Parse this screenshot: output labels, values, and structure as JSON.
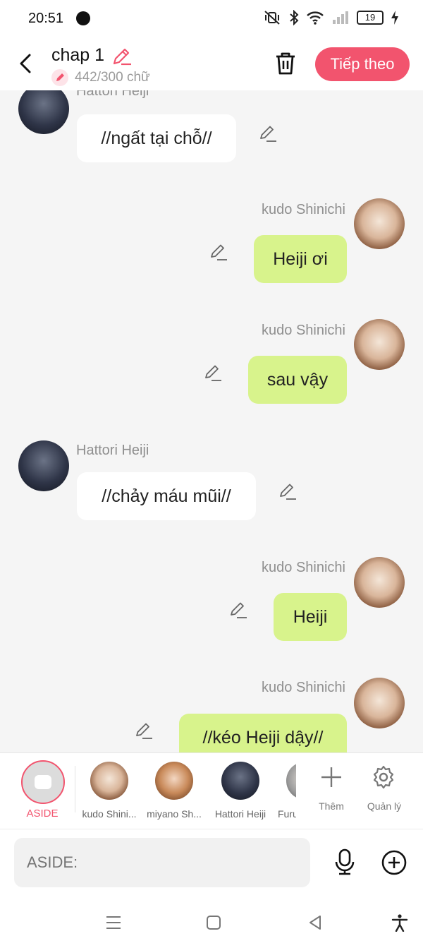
{
  "status": {
    "time": "20:51",
    "battery": "19",
    "icons": [
      "globe-icon",
      "mute-vibrate-icon",
      "bluetooth-icon",
      "wifi-icon",
      "signal-icon",
      "battery-icon",
      "charging-icon"
    ]
  },
  "header": {
    "title": "chap 1",
    "word_count": "442/300 chữ",
    "next_label": "Tiếp theo"
  },
  "messages": [
    {
      "sender": "Hattori Heiji",
      "text": "//ngất tại chỗ//",
      "side": "left"
    },
    {
      "sender": "kudo Shinichi",
      "text": "Heiji ơi",
      "side": "right"
    },
    {
      "sender": "kudo Shinichi",
      "text": "sau vậy",
      "side": "right"
    },
    {
      "sender": "Hattori Heiji",
      "text": "//chảy máu mũi//",
      "side": "left"
    },
    {
      "sender": "kudo Shinichi",
      "text": "Heiji",
      "side": "right"
    },
    {
      "sender": "kudo Shinichi",
      "text": "//kéo Heiji dậy//",
      "side": "right"
    }
  ],
  "characters": {
    "aside_label": "ASIDE",
    "items": [
      {
        "label": "kudo Shini..."
      },
      {
        "label": "miyano Sh..."
      },
      {
        "label": "Hattori Heiji"
      },
      {
        "label": "Furu"
      }
    ],
    "add_label": "Thêm",
    "manage_label": "Quản lý"
  },
  "input": {
    "placeholder": "ASIDE:"
  },
  "colors": {
    "accent": "#f2546e",
    "right_bubble": "#d8f38c",
    "left_bubble": "#ffffff",
    "background": "#f5f5f5"
  }
}
